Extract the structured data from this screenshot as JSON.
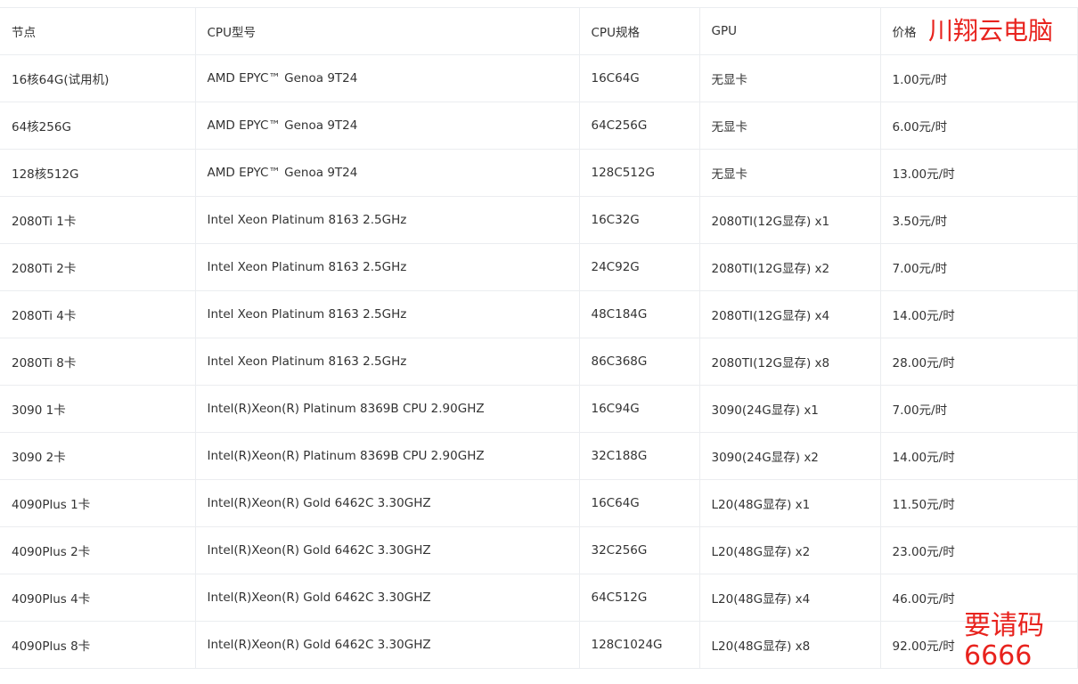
{
  "table": {
    "headers": {
      "node": "节点",
      "cpu_model": "CPU型号",
      "cpu_spec": "CPU规格",
      "gpu": "GPU",
      "price": "价格"
    },
    "rows": [
      {
        "node": "16核64G(试用机)",
        "cpu_model": "AMD EPYC™ Genoa 9T24",
        "cpu_spec": "16C64G",
        "gpu": "无显卡",
        "price": "1.00元/时"
      },
      {
        "node": "64核256G",
        "cpu_model": "AMD EPYC™ Genoa 9T24",
        "cpu_spec": "64C256G",
        "gpu": "无显卡",
        "price": "6.00元/时"
      },
      {
        "node": "128核512G",
        "cpu_model": "AMD EPYC™ Genoa 9T24",
        "cpu_spec": "128C512G",
        "gpu": "无显卡",
        "price": "13.00元/时"
      },
      {
        "node": "2080Ti 1卡",
        "cpu_model": "Intel Xeon Platinum 8163 2.5GHz",
        "cpu_spec": "16C32G",
        "gpu": "2080TI(12G显存) x1",
        "price": "3.50元/时"
      },
      {
        "node": "2080Ti 2卡",
        "cpu_model": "Intel Xeon Platinum 8163 2.5GHz",
        "cpu_spec": "24C92G",
        "gpu": "2080TI(12G显存) x2",
        "price": "7.00元/时"
      },
      {
        "node": "2080Ti 4卡",
        "cpu_model": "Intel Xeon Platinum 8163 2.5GHz",
        "cpu_spec": "48C184G",
        "gpu": "2080TI(12G显存) x4",
        "price": "14.00元/时"
      },
      {
        "node": "2080Ti 8卡",
        "cpu_model": "Intel Xeon Platinum 8163 2.5GHz",
        "cpu_spec": "86C368G",
        "gpu": "2080TI(12G显存) x8",
        "price": "28.00元/时"
      },
      {
        "node": "3090 1卡",
        "cpu_model": "Intel(R)Xeon(R) Platinum 8369B CPU 2.90GHZ",
        "cpu_spec": "16C94G",
        "gpu": "3090(24G显存) x1",
        "price": "7.00元/时"
      },
      {
        "node": "3090 2卡",
        "cpu_model": "Intel(R)Xeon(R) Platinum 8369B CPU 2.90GHZ",
        "cpu_spec": "32C188G",
        "gpu": "3090(24G显存) x2",
        "price": "14.00元/时"
      },
      {
        "node": "4090Plus 1卡",
        "cpu_model": "Intel(R)Xeon(R) Gold 6462C 3.30GHZ",
        "cpu_spec": "16C64G",
        "gpu": "L20(48G显存) x1",
        "price": "11.50元/时"
      },
      {
        "node": "4090Plus 2卡",
        "cpu_model": "Intel(R)Xeon(R) Gold 6462C 3.30GHZ",
        "cpu_spec": "32C256G",
        "gpu": "L20(48G显存) x2",
        "price": "23.00元/时"
      },
      {
        "node": "4090Plus 4卡",
        "cpu_model": "Intel(R)Xeon(R) Gold 6462C 3.30GHZ",
        "cpu_spec": "64C512G",
        "gpu": "L20(48G显存) x4",
        "price": "46.00元/时"
      },
      {
        "node": "4090Plus 8卡",
        "cpu_model": "Intel(R)Xeon(R) Gold 6462C 3.30GHZ",
        "cpu_spec": "128C1024G",
        "gpu": "L20(48G显存) x8",
        "price": "92.00元/时"
      }
    ]
  },
  "overlay": {
    "brand": "川翔云电脑",
    "invite_label": "要请码",
    "invite_code": "6666"
  },
  "colors": {
    "overlay_text": "#e8231e",
    "table_border": "#ebedf0",
    "text": "#333333"
  }
}
